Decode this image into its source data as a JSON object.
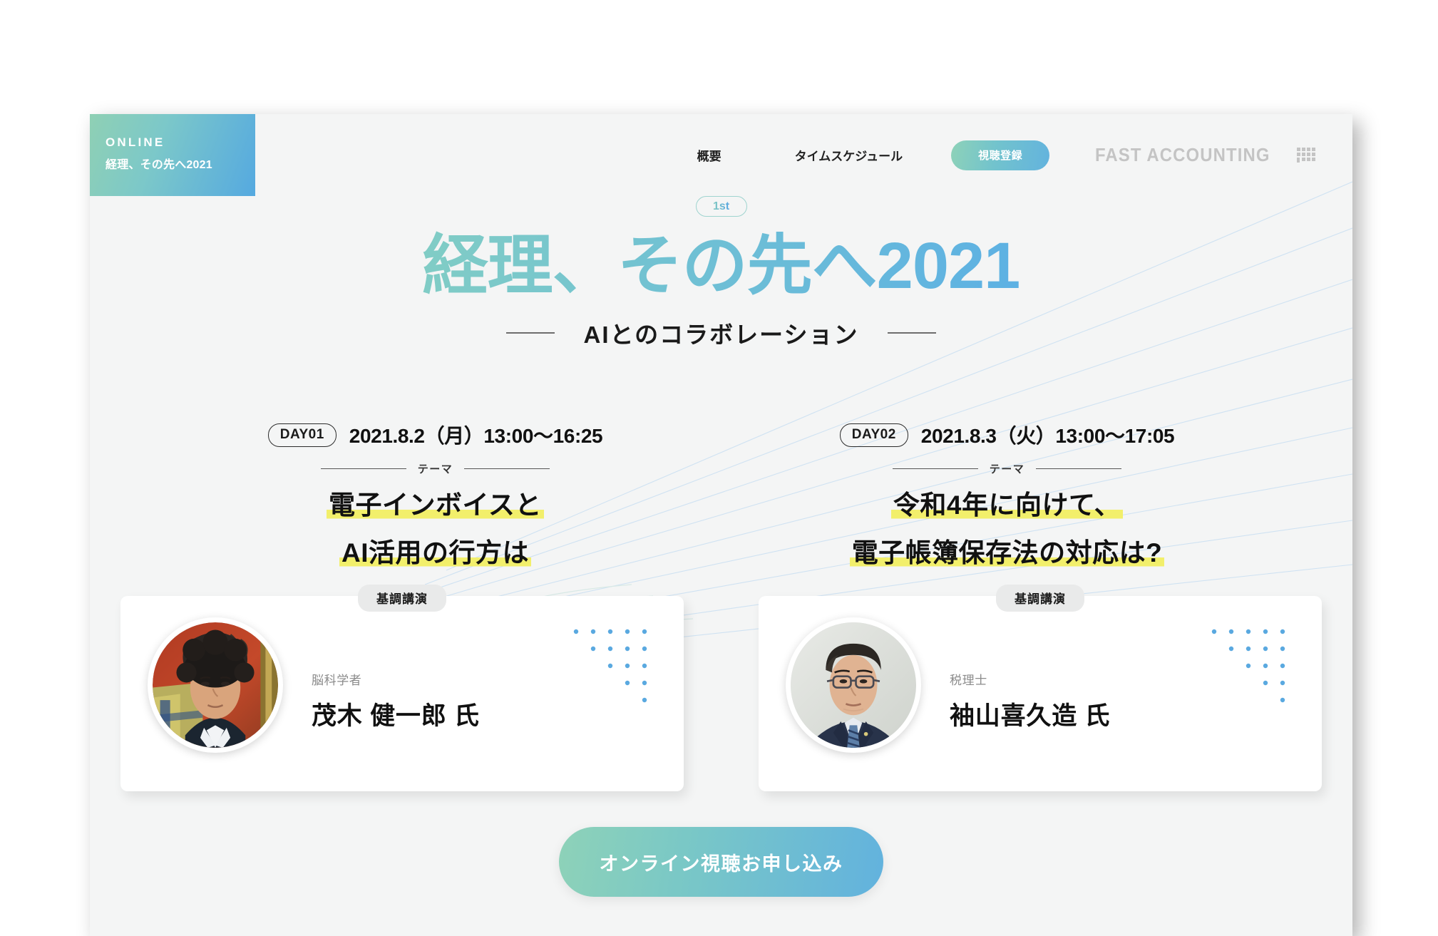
{
  "brand": {
    "badge_online": "ONLINE",
    "badge_subtitle": "経理、その先へ2021",
    "company_name": "FAST ACCOUNTING",
    "company_mark_icon": "pixel-speech-bubble-icon"
  },
  "nav": {
    "overview": "概要",
    "schedule": "タイムスケジュール",
    "register_button": "視聴登録"
  },
  "hero": {
    "edition_badge": "1st",
    "title": "経理、その先へ2021",
    "subtitle": "AIとのコラボレーション"
  },
  "days": [
    {
      "chip": "DAY01",
      "date": "2021.8.2（月）13:00〜16:25",
      "theme_label": "テーマ",
      "theme_line1": "電子インボイスと",
      "theme_line2": "AI活用の行方は",
      "speaker": {
        "badge": "基調講演",
        "role": "脳科学者",
        "name": "茂木 健一郎 氏",
        "avatar_icon": "portrait-photo-avatar"
      }
    },
    {
      "chip": "DAY02",
      "date": "2021.8.3（火）13:00〜17:05",
      "theme_label": "テーマ",
      "theme_line1": "令和4年に向けて、",
      "theme_line2": "電子帳簿保存法の対応は?",
      "speaker": {
        "badge": "基調講演",
        "role": "税理士",
        "name": "袖山喜久造 氏",
        "avatar_icon": "portrait-photo-avatar"
      }
    }
  ],
  "cta": {
    "label": "オンライン視聴お申し込み"
  },
  "colors": {
    "page_background": "#f4f5f5",
    "gradient_green": "#8ed2b8",
    "gradient_blue": "#5aaee6",
    "highlight_yellow": "#f2ef6b",
    "dot_blue": "#5aa9e0",
    "text_dark": "#111111",
    "muted_gray": "#8b8b8b"
  }
}
